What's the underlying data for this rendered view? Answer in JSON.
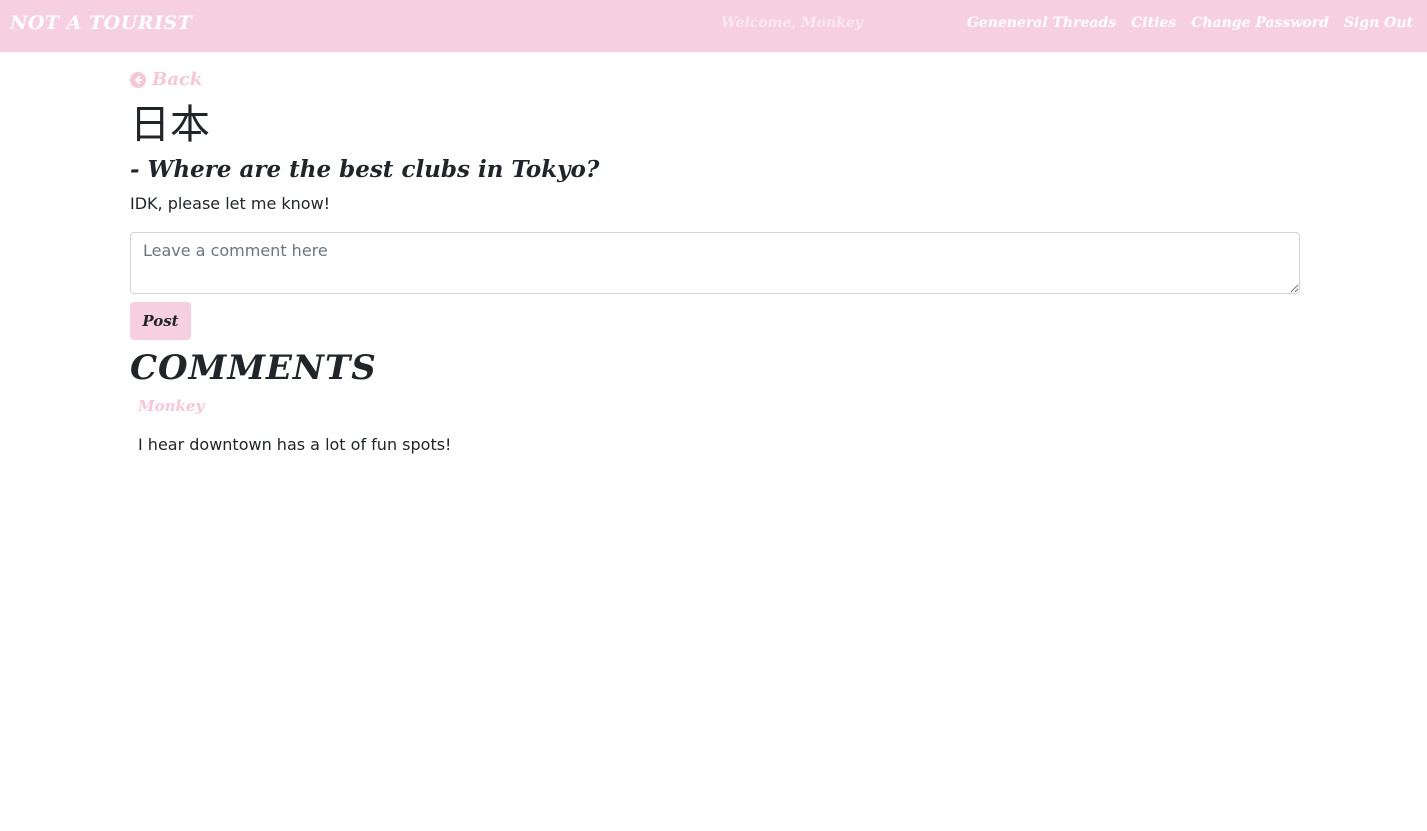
{
  "header": {
    "brand": "NOT A TOURIST",
    "welcome": "Welcome, Monkey",
    "nav_items": [
      {
        "label": "Geneneral Threads"
      },
      {
        "label": "Cities"
      },
      {
        "label": "Change Password"
      },
      {
        "label": "Sign Out"
      }
    ]
  },
  "main": {
    "back_label": "Back",
    "city_title": "日本",
    "thread_title": "- Where are the best clubs in Tokyo?",
    "thread_body": "IDK, please let me know!",
    "comment_input": {
      "placeholder": "Leave a comment here",
      "value": ""
    },
    "post_label": "Post",
    "comments_heading": "COMMENTS",
    "comments": [
      {
        "author": "Monkey",
        "text": "I hear downtown has a lot of fun spots!"
      }
    ]
  },
  "colors": {
    "accent": "#f6d0e0",
    "accent_text": "#f6c6d9",
    "text": "#212529"
  }
}
